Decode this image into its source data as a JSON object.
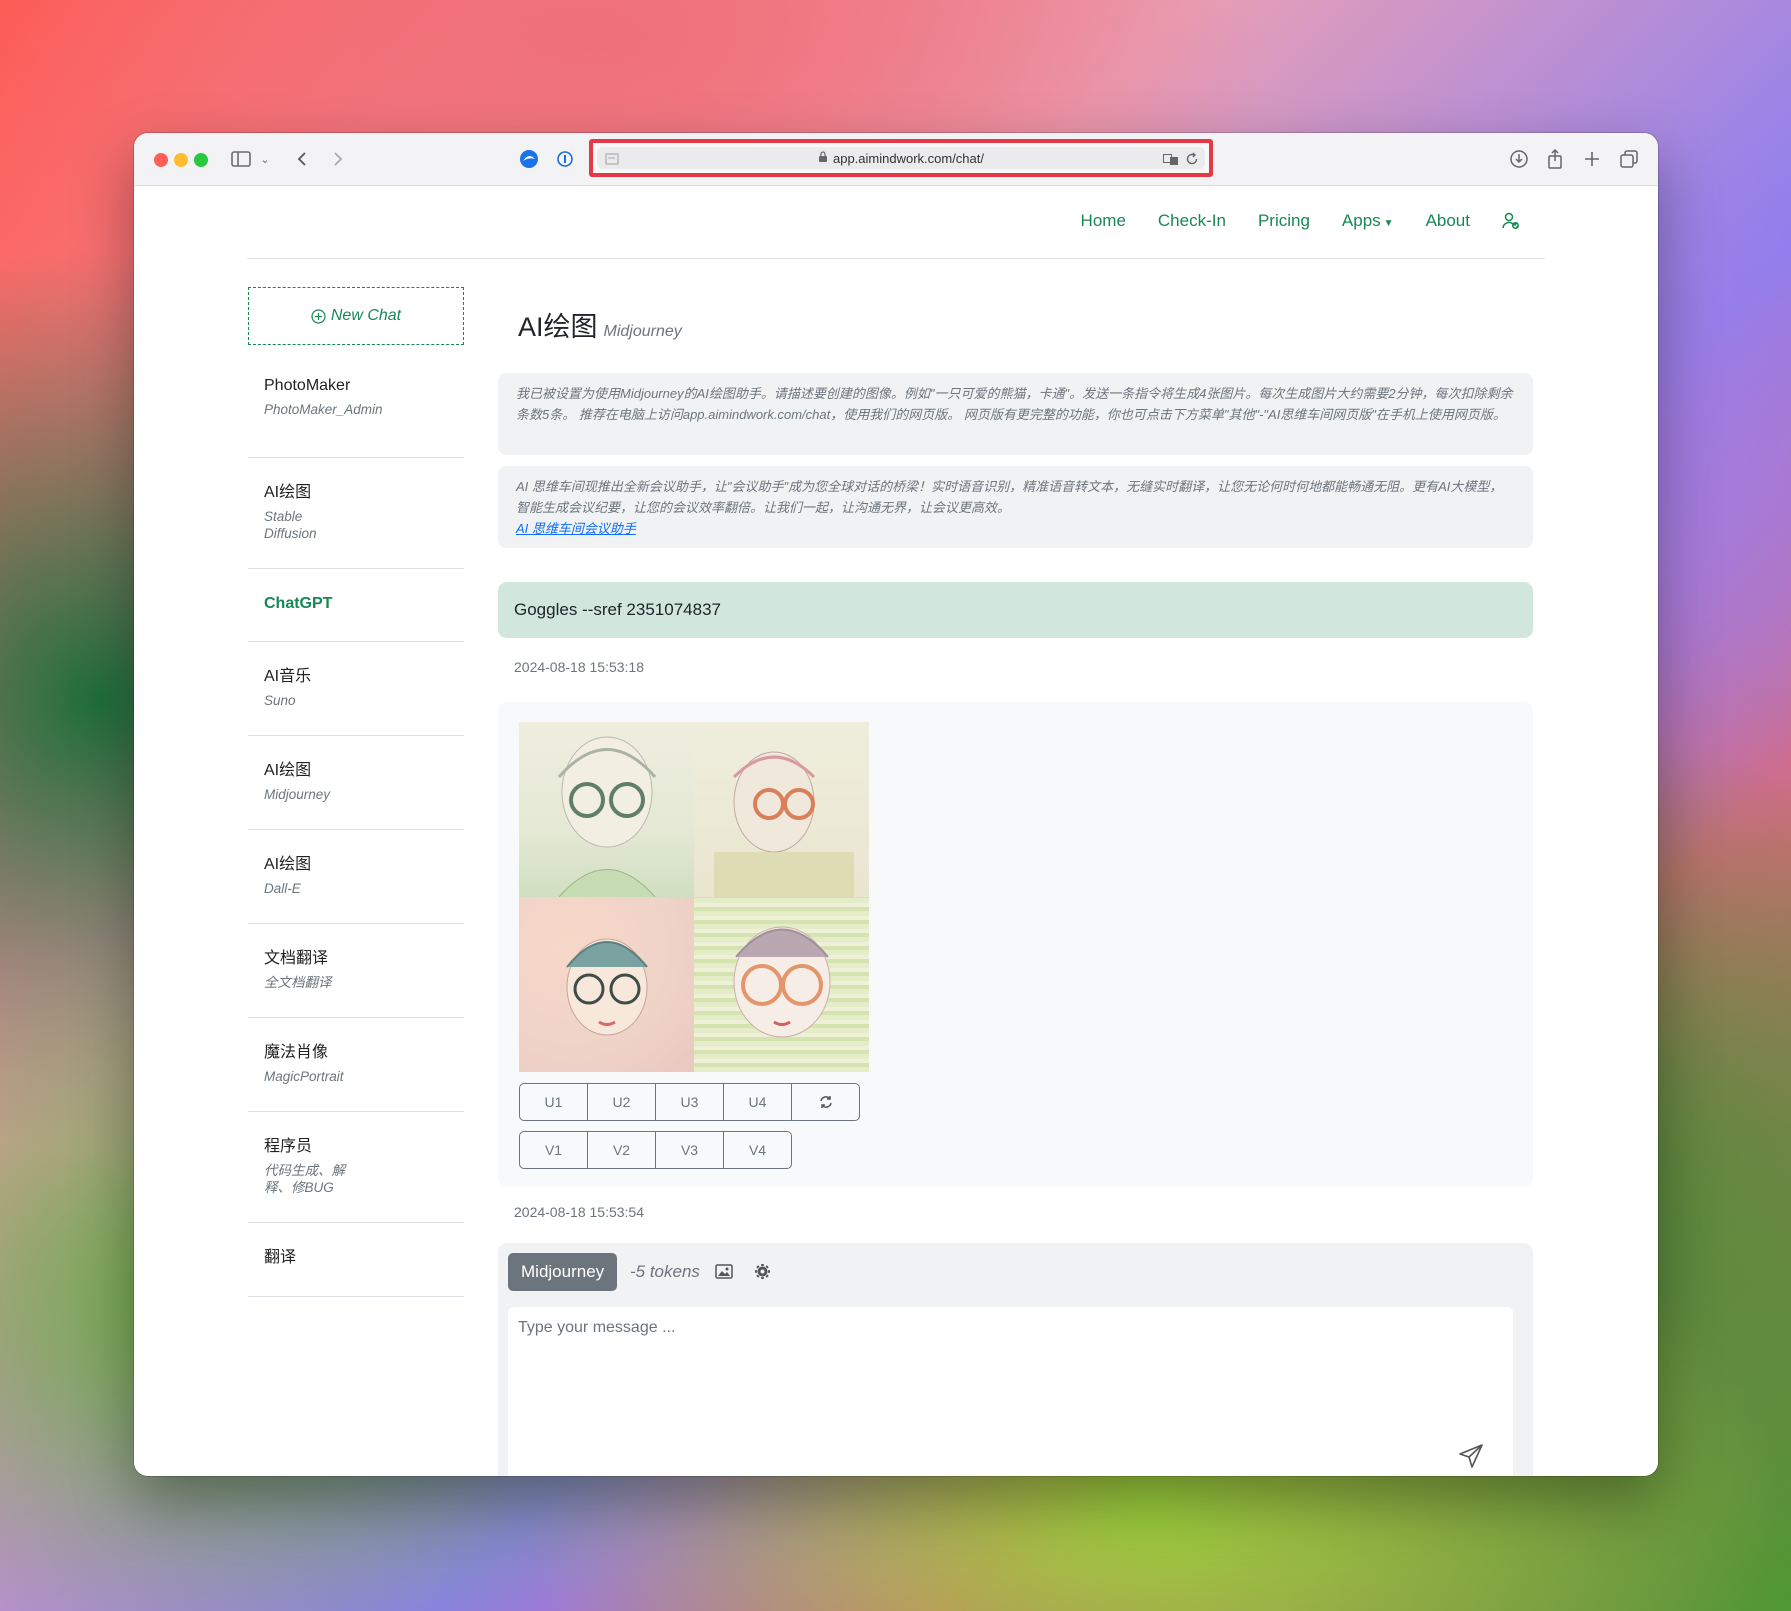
{
  "browser": {
    "url": "app.aimindwork.com/chat/"
  },
  "nav": {
    "items": [
      "Home",
      "Check-In",
      "Pricing",
      "Apps",
      "About"
    ]
  },
  "sidebar": {
    "new_chat": "New Chat",
    "items": [
      {
        "title": "PhotoMaker",
        "subtitle": "PhotoMaker_Admin"
      },
      {
        "title": "AI绘图",
        "subtitle": "Stable Diffusion"
      },
      {
        "title": "ChatGPT",
        "subtitle": ""
      },
      {
        "title": "AI音乐",
        "subtitle": "Suno"
      },
      {
        "title": "AI绘图",
        "subtitle": "Midjourney"
      },
      {
        "title": "AI绘图",
        "subtitle": "Dall-E"
      },
      {
        "title": "文档翻译",
        "subtitle": "全文档翻译"
      },
      {
        "title": "魔法肖像",
        "subtitle": "MagicPortrait"
      },
      {
        "title": "程序员",
        "subtitle": "代码生成、解释、修BUG"
      },
      {
        "title": "翻译",
        "subtitle": ""
      }
    ]
  },
  "main": {
    "title": "AI绘图",
    "subtitle": "Midjourney",
    "notice1": "我已被设置为使用Midjourney的AI绘图助手。请描述要创建的图像。例如\"一只可爱的熊猫，卡通\"。发送一条指令将生成4张图片。每次生成图片大约需要2分钟，每次扣除剩余条数5条。 推荐在电脑上访问app.aimindwork.com/chat，使用我们的网页版。 网页版有更完整的功能，你也可点击下方菜单\"其他\"-\"AI思维车间网页版\"在手机上使用网页版。",
    "notice2": "AI 思维车间现推出全新会议助手，让\"会议助手\"成为您全球对话的桥梁！实时语音识别，精准语音转文本，无缝实时翻译，让您无论何时何地都能畅通无阻。更有AI大模型，智能生成会议纪要，让您的会议效率翻倍。让我们一起，让沟通无界，让会议更高效。",
    "notice2_link": "AI 思维车间会议助手",
    "user_message": "Goggles --sref 2351074837",
    "user_time": "2024-08-18 15:53:18",
    "upscale_buttons": [
      "U1",
      "U2",
      "U3",
      "U4"
    ],
    "variation_buttons": [
      "V1",
      "V2",
      "V3",
      "V4"
    ],
    "response_time": "2024-08-18 15:53:54"
  },
  "composer": {
    "model": "Midjourney",
    "tokens": "-5 tokens",
    "placeholder": "Type your message ..."
  }
}
